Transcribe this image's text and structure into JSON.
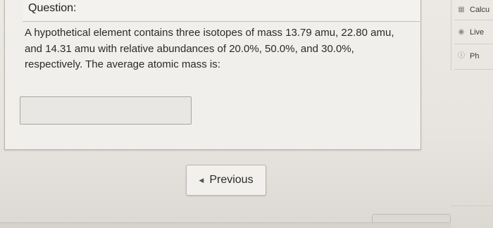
{
  "question": {
    "heading": "Question:",
    "text": "A hypothetical element contains three isotopes of mass 13.79 amu, 22.80 amu, and 14.31 amu with relative abundances of 20.0%, 50.0%, and 30.0%, respectively. The average atomic mass is:",
    "answer_value": "",
    "answer_placeholder": ""
  },
  "navigation": {
    "previous_label": "Previous",
    "previous_icon": "caret-left-icon"
  },
  "side_tools": [
    {
      "label": "Calcu",
      "icon": "calculator-icon"
    },
    {
      "label": "Live",
      "icon": "chat-icon"
    },
    {
      "label": "Ph",
      "icon": "info-icon"
    }
  ]
}
